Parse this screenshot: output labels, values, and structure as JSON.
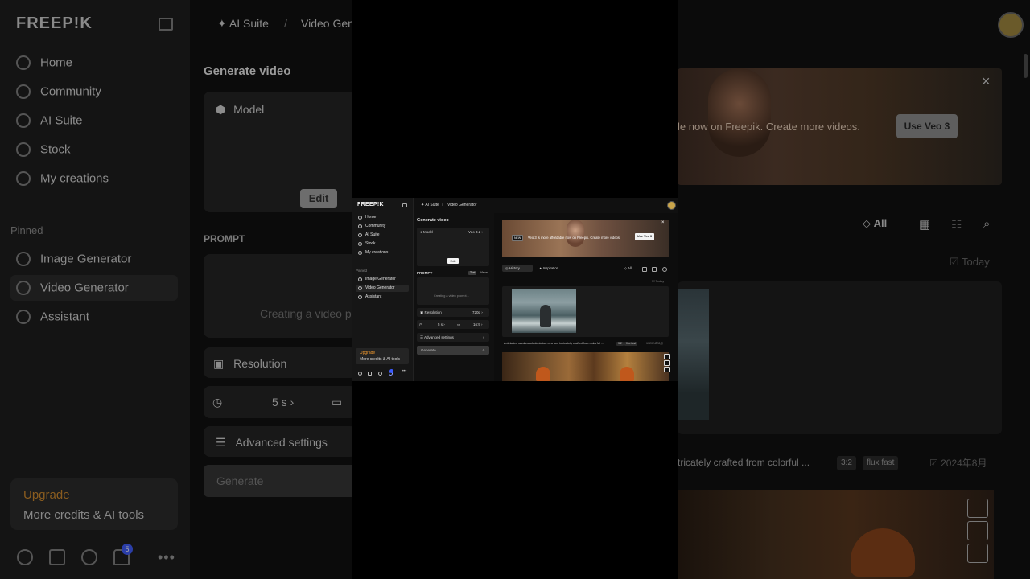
{
  "app": {
    "logo": "FREEP!K",
    "user_avatar": "user-avatar"
  },
  "sidebar": {
    "items": [
      {
        "label": "Home",
        "icon": "home-icon"
      },
      {
        "label": "Community",
        "icon": "globe-icon"
      },
      {
        "label": "AI Suite",
        "icon": "sparkle-icon"
      },
      {
        "label": "Stock",
        "icon": "search-icon"
      },
      {
        "label": "My creations",
        "icon": "folder-icon"
      }
    ],
    "pinned_label": "Pinned",
    "pinned": [
      {
        "label": "Image Generator",
        "icon": "image-icon"
      },
      {
        "label": "Video Generator",
        "icon": "video-icon",
        "active": true
      },
      {
        "label": "Assistant",
        "icon": "chat-icon"
      }
    ],
    "upgrade": {
      "title": "Upgrade",
      "subtitle": "More credits & AI tools"
    },
    "notifications_count": "5"
  },
  "breadcrumb": {
    "root": "AI Suite",
    "separator": "/",
    "current": "Video Generator",
    "current_truncated": "Video Gene"
  },
  "generate_panel": {
    "title": "Generate video",
    "model_label": "Model",
    "model_value": "Veo 3.2",
    "edit_label": "Edit",
    "prompt_label": "PROMPT",
    "prompt_tabs": [
      "Text",
      "Visual"
    ],
    "prompt_placeholder": "Creating a video prompt...",
    "prompt_placeholder_bg": "Creating a video pro",
    "resolution_label": "Resolution",
    "resolution_value": "720p",
    "duration_value": "5 s",
    "aspect_value": "16:9",
    "advanced_label": "Advanced settings",
    "generate_label": "Generate"
  },
  "banner": {
    "new_badge": "NEW",
    "text": "Veo 3 is more affordable now on Freepik. Create more videos.",
    "text_bg": "le now on Freepik. Create more videos.",
    "button": "Use Veo 3",
    "close": "×"
  },
  "history_toolbar": {
    "history_label": "History",
    "inspiration_label": "Inspiration",
    "filter_all": "All",
    "today_label": "Today"
  },
  "items": [
    {
      "description": "A detailed needlework depiction of a fox, intricately crafted from colorful ...",
      "description_bg": "tricately crafted from colorful ...",
      "ratio": "3:2",
      "model": "flux fast",
      "date": "2024年8月",
      "date_short": "2024年8月"
    }
  ],
  "colors": {
    "accent_upgrade": "#f29a2e",
    "notification": "#3b5bff",
    "background": "#101010"
  }
}
